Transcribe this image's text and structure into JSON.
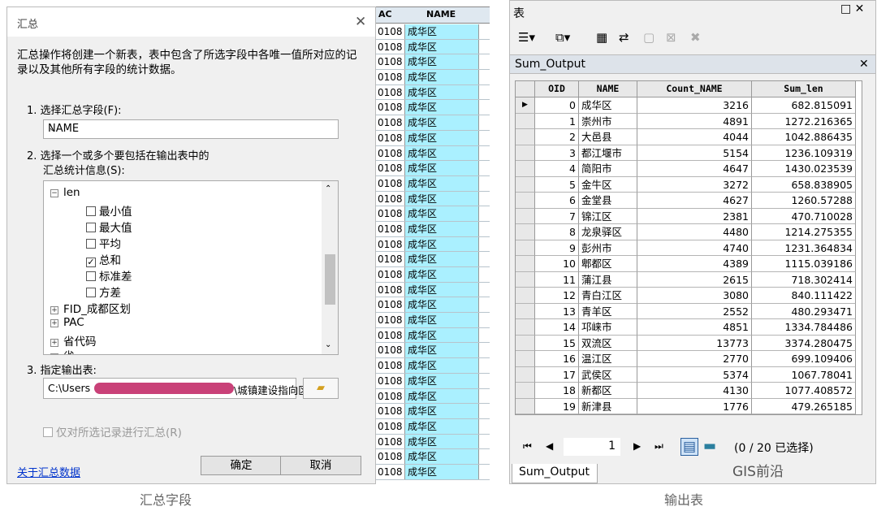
{
  "dialog": {
    "title": "汇总",
    "close": "✕",
    "description": "汇总操作将创建一个新表，表中包含了所选字段中各唯一值所对应的记录以及其他所有字段的统计数据。",
    "step1_label": "1. 选择汇总字段(F):",
    "field_value": "NAME",
    "step2_label": "2. 选择一个或多个要包括在输出表中的",
    "step2_label2": "汇总统计信息(S):",
    "tree": {
      "len": "len",
      "min": "最小值",
      "max": "最大值",
      "avg": "平均",
      "sum": "总和",
      "std": "标准差",
      "var": "方差",
      "fid": "FID_成都区划",
      "pac": "PAC",
      "prov": "省代码",
      "cut": "省"
    },
    "step3_label": "3. 指定输出表:",
    "output_prefix": "C:\\Users",
    "output_suffix": "\\城镇建设指向区位",
    "only_selected": "仅对所选记录进行汇总(R)",
    "about_link": "关于汇总数据",
    "ok": "确定",
    "cancel": "取消"
  },
  "bg_table": {
    "col_pac": "AC",
    "col_name": "NAME",
    "pac_value": "0108",
    "name_value": "成华区"
  },
  "window": {
    "title": "表",
    "ctrl": "□ ✕",
    "tab_name": "Sum_Output",
    "columns": [
      "OID",
      "NAME",
      "Count_NAME",
      "Sum_len"
    ],
    "rows": [
      [
        "0",
        "成华区",
        "3216",
        "682.815091"
      ],
      [
        "1",
        "崇州市",
        "4891",
        "1272.216365"
      ],
      [
        "2",
        "大邑县",
        "4044",
        "1042.886435"
      ],
      [
        "3",
        "都江堰市",
        "5154",
        "1236.109319"
      ],
      [
        "4",
        "简阳市",
        "4647",
        "1430.023539"
      ],
      [
        "5",
        "金牛区",
        "3272",
        "658.838905"
      ],
      [
        "6",
        "金堂县",
        "4627",
        "1260.57288"
      ],
      [
        "7",
        "锦江区",
        "2381",
        "470.710028"
      ],
      [
        "8",
        "龙泉驿区",
        "4480",
        "1214.275355"
      ],
      [
        "9",
        "彭州市",
        "4740",
        "1231.364834"
      ],
      [
        "10",
        "郫都区",
        "4389",
        "1115.039186"
      ],
      [
        "11",
        "蒲江县",
        "2615",
        "718.302414"
      ],
      [
        "12",
        "青白江区",
        "3080",
        "840.111422"
      ],
      [
        "13",
        "青羊区",
        "2552",
        "480.293471"
      ],
      [
        "14",
        "邛崃市",
        "4851",
        "1334.784486"
      ],
      [
        "15",
        "双流区",
        "13773",
        "3374.280475"
      ],
      [
        "16",
        "温江区",
        "2770",
        "699.109406"
      ],
      [
        "17",
        "武侯区",
        "5374",
        "1067.78041"
      ],
      [
        "18",
        "新都区",
        "4130",
        "1077.408572"
      ],
      [
        "19",
        "新津县",
        "1776",
        "479.265185"
      ]
    ],
    "page": "1",
    "status": "(0 / 20 已选择)",
    "bottom_tab": "Sum_Output"
  },
  "captions": {
    "left": "汇总字段",
    "right": "输出表"
  },
  "watermark": "GIS前沿"
}
